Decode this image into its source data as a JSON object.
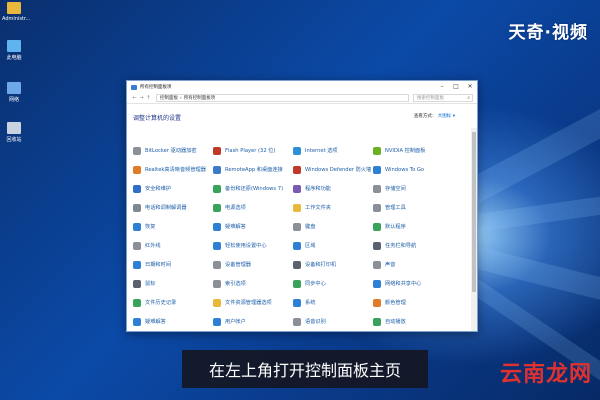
{
  "desktop": {
    "icons": [
      {
        "label": "Administr...",
        "icon": "folder-icon",
        "color": "#e9b73c"
      },
      {
        "label": "此电脑",
        "icon": "computer-icon",
        "color": "#5fb4f0"
      },
      {
        "label": "网络",
        "icon": "network-icon",
        "color": "#6fa8e8"
      },
      {
        "label": "回收站",
        "icon": "recycle-bin-icon",
        "color": "#c9d3df"
      }
    ]
  },
  "watermarks": {
    "top": "天奇·视频",
    "bottom": "云南龙网"
  },
  "window": {
    "title": "所有控制面板项",
    "address": {
      "path": [
        "控制面板",
        "所有控制面板项"
      ]
    },
    "search_placeholder": "搜索控制面板",
    "heading": "调整计算机的设置",
    "view_by_label": "查看方式：",
    "view_by_value": "大图标 ▾",
    "items": [
      {
        "label": "BitLocker 驱动器加密",
        "color": "#8a8f98"
      },
      {
        "label": "Flash Player (32 位)",
        "color": "#c0392b"
      },
      {
        "label": "Internet 选项",
        "color": "#2d8fd4"
      },
      {
        "label": "NVIDIA 控制面板",
        "color": "#6ab023"
      },
      {
        "label": "Realtek高清晰音频管理器",
        "color": "#e07b2a"
      },
      {
        "label": "RemoteApp 和桌面连接",
        "color": "#3b7bc8"
      },
      {
        "label": "Windows Defender 防火墙",
        "color": "#c0392b"
      },
      {
        "label": "Windows To Go",
        "color": "#2e7fd6"
      },
      {
        "label": "安全和维护",
        "color": "#2e6fc8"
      },
      {
        "label": "备份和还原(Windows 7)",
        "color": "#3aa35b"
      },
      {
        "label": "程序和功能",
        "color": "#7a5ab5"
      },
      {
        "label": "存储空间",
        "color": "#8a8f98"
      },
      {
        "label": "电话和调制解调器",
        "color": "#7f8891"
      },
      {
        "label": "电源选项",
        "color": "#3aa35b"
      },
      {
        "label": "工作文件夹",
        "color": "#e9b73c"
      },
      {
        "label": "管理工具",
        "color": "#8a8f98"
      },
      {
        "label": "恢复",
        "color": "#2e7fd6"
      },
      {
        "label": "疑难解答",
        "color": "#2e7fd6"
      },
      {
        "label": "键盘",
        "color": "#8a8f98"
      },
      {
        "label": "默认程序",
        "color": "#3aa35b"
      },
      {
        "label": "红外线",
        "color": "#8a8f98"
      },
      {
        "label": "轻松使用设置中心",
        "color": "#2e7fd6"
      },
      {
        "label": "区域",
        "color": "#2e7fd6"
      },
      {
        "label": "任务栏和导航",
        "color": "#5a6270"
      },
      {
        "label": "日期和时间",
        "color": "#2e7fd6"
      },
      {
        "label": "设备管理器",
        "color": "#8a8f98"
      },
      {
        "label": "设备和打印机",
        "color": "#5a6270"
      },
      {
        "label": "声音",
        "color": "#8a8f98"
      },
      {
        "label": "鼠标",
        "color": "#5a6270"
      },
      {
        "label": "索引选项",
        "color": "#8a8f98"
      },
      {
        "label": "同步中心",
        "color": "#3aa35b"
      },
      {
        "label": "网络和共享中心",
        "color": "#2e7fd6"
      },
      {
        "label": "文件历史记录",
        "color": "#3aa35b"
      },
      {
        "label": "文件资源管理器选项",
        "color": "#e9b73c"
      },
      {
        "label": "系统",
        "color": "#2e7fd6"
      },
      {
        "label": "颜色管理",
        "color": "#e07b2a"
      },
      {
        "label": "疑难解答",
        "color": "#2e7fd6"
      },
      {
        "label": "用户帐户",
        "color": "#2e7fd6"
      },
      {
        "label": "语音识别",
        "color": "#8a8f98"
      },
      {
        "label": "自动播放",
        "color": "#3aa35b"
      }
    ]
  },
  "subtitle": "在左上角打开控制面板主页"
}
